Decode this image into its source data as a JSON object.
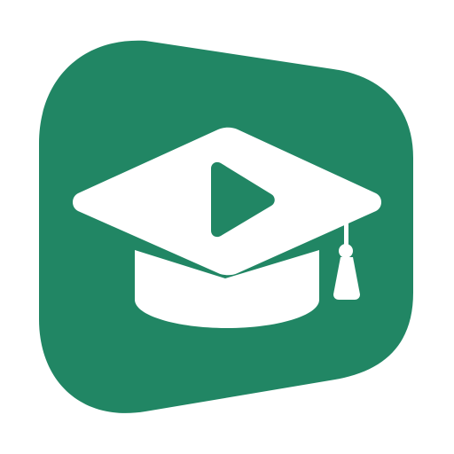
{
  "app_icon": {
    "name": "graduation-cap-play-icon",
    "colors": {
      "background": "#ffffff",
      "brand_green": "#218664",
      "foreground": "#ffffff"
    }
  }
}
